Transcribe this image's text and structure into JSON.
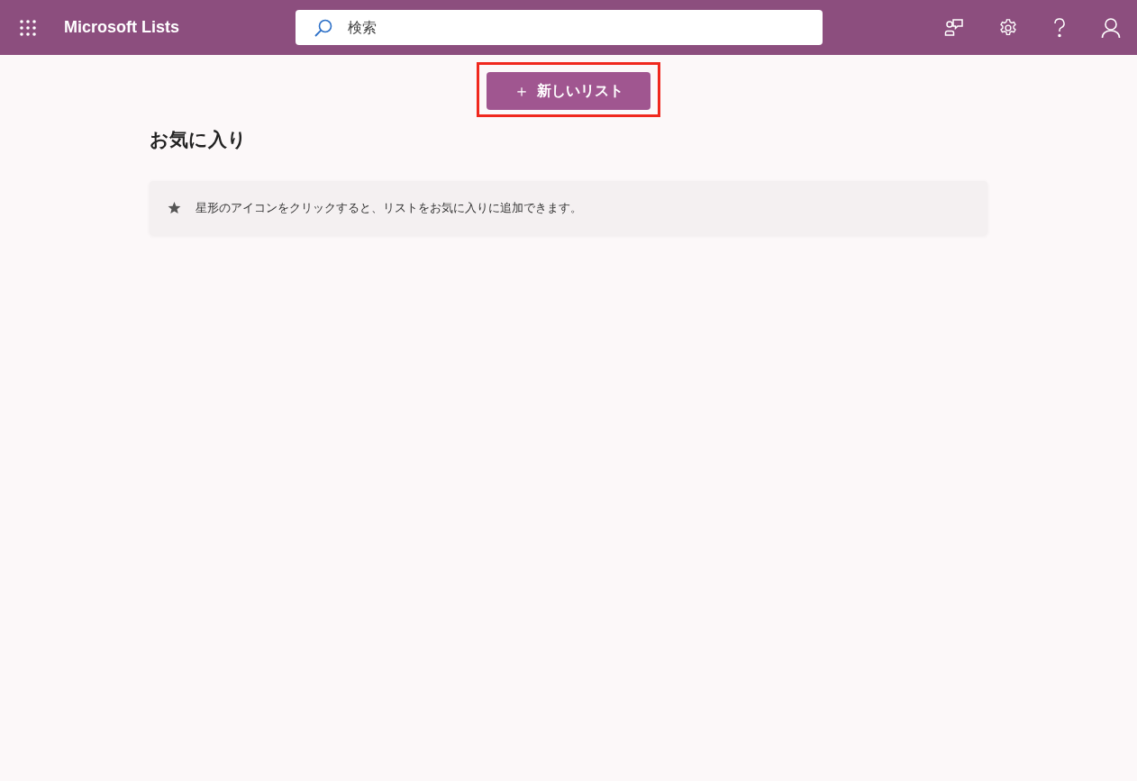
{
  "header": {
    "app_title": "Microsoft Lists",
    "search": {
      "placeholder": "検索"
    }
  },
  "new_list_button": {
    "label": "＋",
    "text": "新しいリスト",
    "highlighted": true
  },
  "favorites": {
    "heading": "お気に入り",
    "hint": "星形のアイコンをクリックすると、リストをお気に入りに追加できます。"
  }
}
